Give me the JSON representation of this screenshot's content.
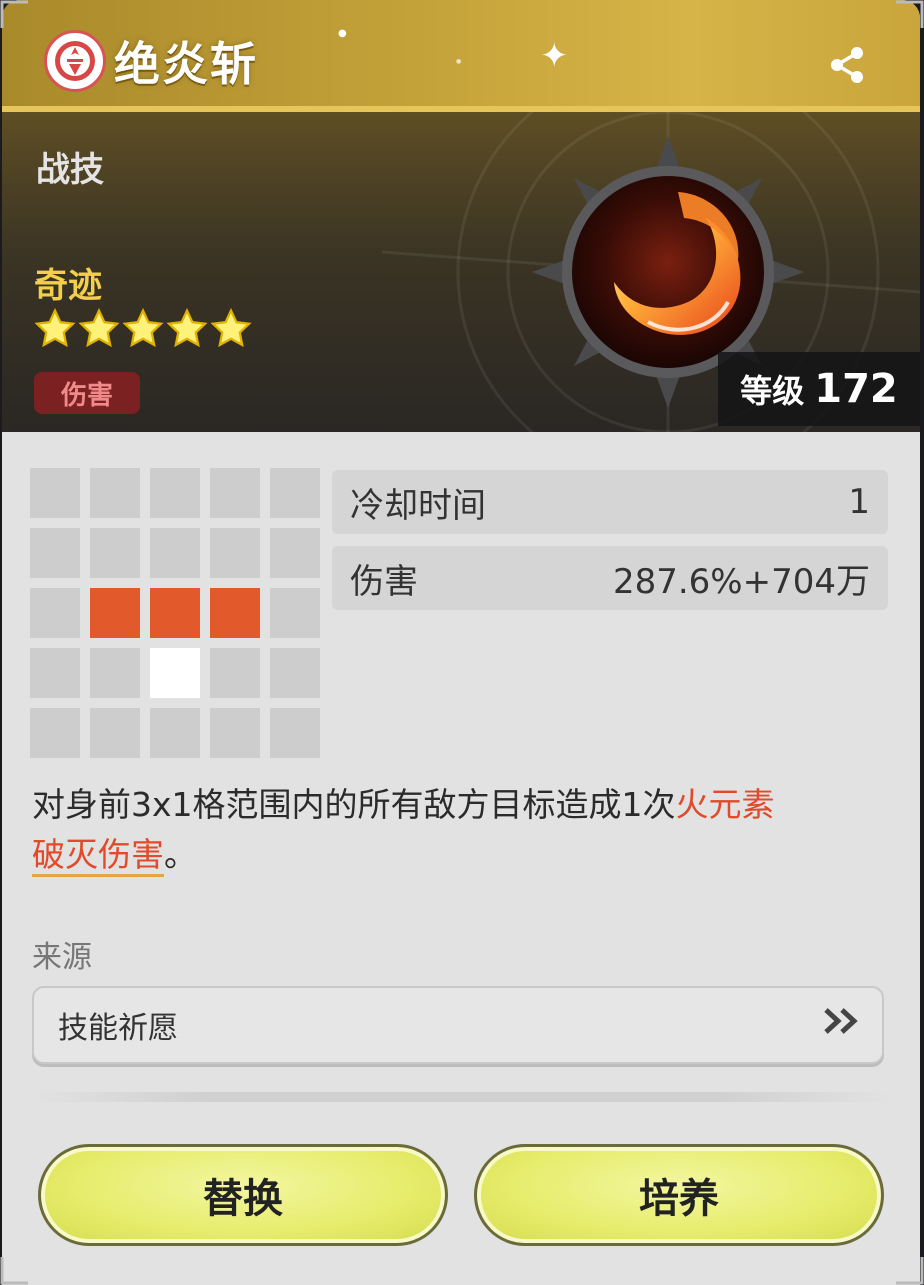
{
  "header": {
    "title": "绝炎斩",
    "share_icon": "share-icon",
    "emblem_icon": "faction-emblem-icon"
  },
  "hero": {
    "type_label": "战技",
    "rarity_label": "奇迹",
    "stars": 5,
    "tag": "伤害",
    "skill_icon": "fire-slash-icon",
    "level_label": "等级",
    "level_value": "172"
  },
  "range_grid": {
    "rows": [
      [
        0,
        0,
        0,
        0,
        0
      ],
      [
        0,
        0,
        0,
        0,
        0
      ],
      [
        0,
        1,
        1,
        1,
        0
      ],
      [
        0,
        0,
        2,
        0,
        0
      ],
      [
        0,
        0,
        0,
        0,
        0
      ]
    ]
  },
  "stats": [
    {
      "label": "冷却时间",
      "value": "1"
    },
    {
      "label": "伤害",
      "value": "287.6%+704万"
    }
  ],
  "description": {
    "text": "对身前3x1格范围内的所有敌方目标造成1次",
    "highlight": "火元素",
    "underlined": "破灭伤害",
    "suffix": "。"
  },
  "source": {
    "label": "来源",
    "item": "技能祈愿",
    "arrow_icon": "double-chevron-right-icon"
  },
  "buttons": {
    "replace": "替换",
    "cultivate": "培养"
  },
  "colors": {
    "header_gold": "#c4a23a",
    "accent_line": "#e6c65a",
    "rarity_gold": "#f3cf4a",
    "damage_tag_bg": "#7b2121",
    "hit_cell": "#e25a2c",
    "highlight_text": "#e14a2a",
    "button_fill": "#e6ec6a"
  }
}
